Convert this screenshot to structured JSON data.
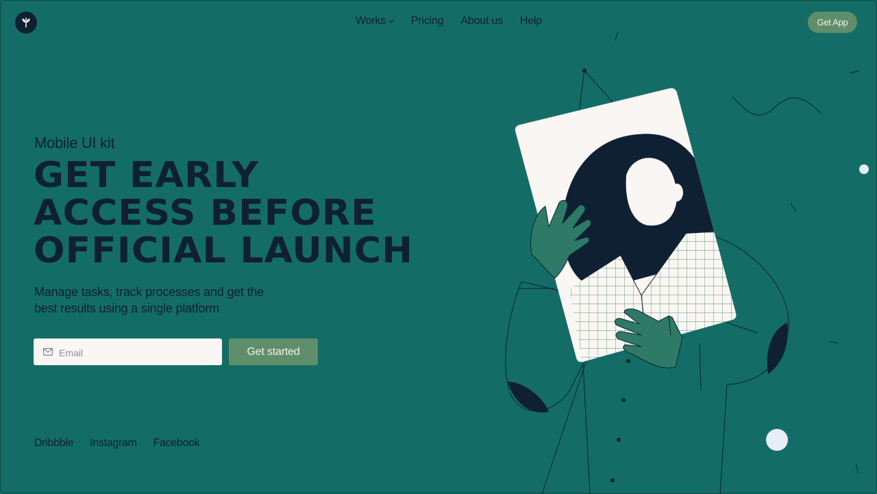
{
  "header": {
    "logo_icon": "leaf-icon",
    "nav": [
      {
        "label": "Works",
        "has_dropdown": true
      },
      {
        "label": "Pricing"
      },
      {
        "label": "About us"
      },
      {
        "label": "Help"
      }
    ],
    "get_app_label": "Get App"
  },
  "hero": {
    "eyebrow": "Mobile UI kit",
    "headline_lines": [
      "Get early",
      "access before",
      "official launch"
    ],
    "subtitle": "Manage tasks, track processes and get the best results using a single platform",
    "email_placeholder": "Email",
    "email_value": "",
    "cta_label": "Get started"
  },
  "social": [
    "Dribbble",
    "Instagram",
    "Facebook"
  ],
  "colors": {
    "background": "#136d66",
    "ink": "#0f2033",
    "accent": "#5f8f6a",
    "paper": "#faf6f3"
  }
}
